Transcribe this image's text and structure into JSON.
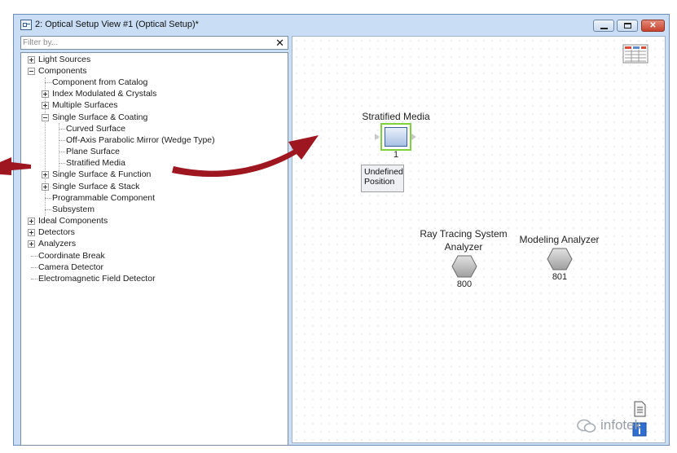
{
  "window": {
    "title": "2: Optical Setup View #1 (Optical Setup)*"
  },
  "filter": {
    "placeholder": "Filter by...",
    "value": "",
    "clear_glyph": "✕"
  },
  "tree": {
    "items": [
      {
        "label": "Light Sources",
        "state": "collapsed"
      },
      {
        "label": "Components",
        "state": "expanded"
      },
      {
        "label": "Component from Catalog",
        "state": "leaf"
      },
      {
        "label": "Index Modulated & Crystals",
        "state": "collapsed"
      },
      {
        "label": "Multiple Surfaces",
        "state": "collapsed"
      },
      {
        "label": "Single Surface & Coating",
        "state": "expanded"
      },
      {
        "label": "Curved Surface",
        "state": "leaf"
      },
      {
        "label": "Off-Axis Parabolic Mirror (Wedge Type)",
        "state": "leaf"
      },
      {
        "label": "Plane Surface",
        "state": "leaf"
      },
      {
        "label": "Stratified Media",
        "state": "leaf"
      },
      {
        "label": "Single Surface & Function",
        "state": "collapsed"
      },
      {
        "label": "Single Surface & Stack",
        "state": "collapsed"
      },
      {
        "label": "Programmable Component",
        "state": "leaf"
      },
      {
        "label": "Subsystem",
        "state": "leaf"
      },
      {
        "label": "Ideal Components",
        "state": "collapsed"
      },
      {
        "label": "Detectors",
        "state": "collapsed"
      },
      {
        "label": "Analyzers",
        "state": "collapsed"
      },
      {
        "label": "Coordinate Break",
        "state": "leaf"
      },
      {
        "label": "Camera Detector",
        "state": "leaf"
      },
      {
        "label": "Electromagnetic Field Detector",
        "state": "leaf"
      }
    ]
  },
  "canvas": {
    "component": {
      "name": "Stratified Media",
      "index": "1",
      "status_line1": "Undefined",
      "status_line2": "Position"
    },
    "analyzers": [
      {
        "name_line1": "Ray Tracing System",
        "name_line2": "Analyzer",
        "index": "800"
      },
      {
        "name_line1": "Modeling Analyzer",
        "name_line2": "",
        "index": "801"
      }
    ]
  },
  "watermark": {
    "text": "infotek"
  },
  "colors": {
    "annotation_arrow": "#9e1620",
    "selection_border": "#7fd23f",
    "titlebar": "#c9def5",
    "close_button": "#c7432e"
  },
  "icons": [
    "application-icon",
    "minimize-icon",
    "maximize-icon",
    "close-icon",
    "clear-filter-icon",
    "table-view-icon",
    "document-icon",
    "info-icon",
    "wechat-icon"
  ]
}
